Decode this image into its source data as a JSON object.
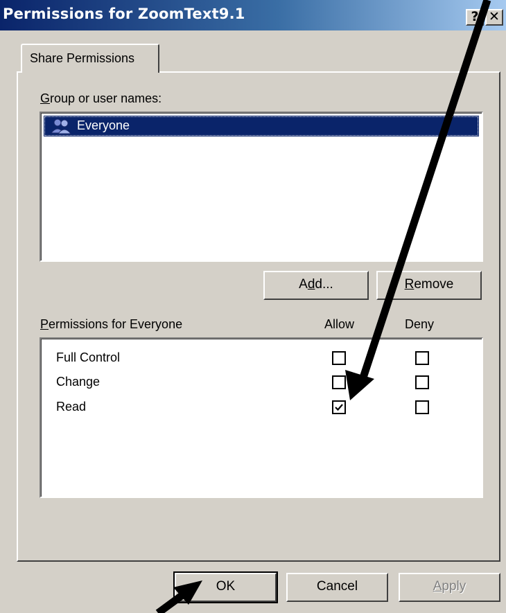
{
  "window": {
    "title": "Permissions for ZoomText9.1",
    "help_icon": "help-icon",
    "close_icon": "close-icon"
  },
  "tabs": [
    {
      "label": "Share Permissions",
      "selected": true
    }
  ],
  "groups": {
    "label": "Group or user names:",
    "label_mnemonic": "G",
    "label_rest": "roup or user names:",
    "items": [
      {
        "name": "Everyone",
        "icon": "user-group-icon",
        "selected": true
      }
    ]
  },
  "buttons": {
    "add": {
      "pre": "A",
      "mnemonic": "d",
      "post": "d...",
      "label": "Add..."
    },
    "remove": {
      "mnemonic": "R",
      "post": "emove",
      "label": "Remove"
    },
    "ok": "OK",
    "cancel": "Cancel",
    "apply": {
      "mnemonic": "A",
      "post": "pply",
      "label": "Apply",
      "disabled": true
    }
  },
  "permissions": {
    "label": "Permissions for Everyone",
    "label_mnemonic": "P",
    "label_rest": "ermissions for Everyone",
    "col_allow": "Allow",
    "col_deny": "Deny",
    "rows": [
      {
        "name": "Full Control",
        "allow": false,
        "deny": false
      },
      {
        "name": "Change",
        "allow": false,
        "deny": false
      },
      {
        "name": "Read",
        "allow": true,
        "deny": false
      }
    ]
  },
  "colors": {
    "title_start": "#0a246a",
    "title_end": "#a6caf0",
    "face": "#d4d0c8",
    "selection": "#0a246a"
  },
  "annotations": [
    "arrow pointing to Read Allow checkbox",
    "arrow pointing to OK button"
  ]
}
